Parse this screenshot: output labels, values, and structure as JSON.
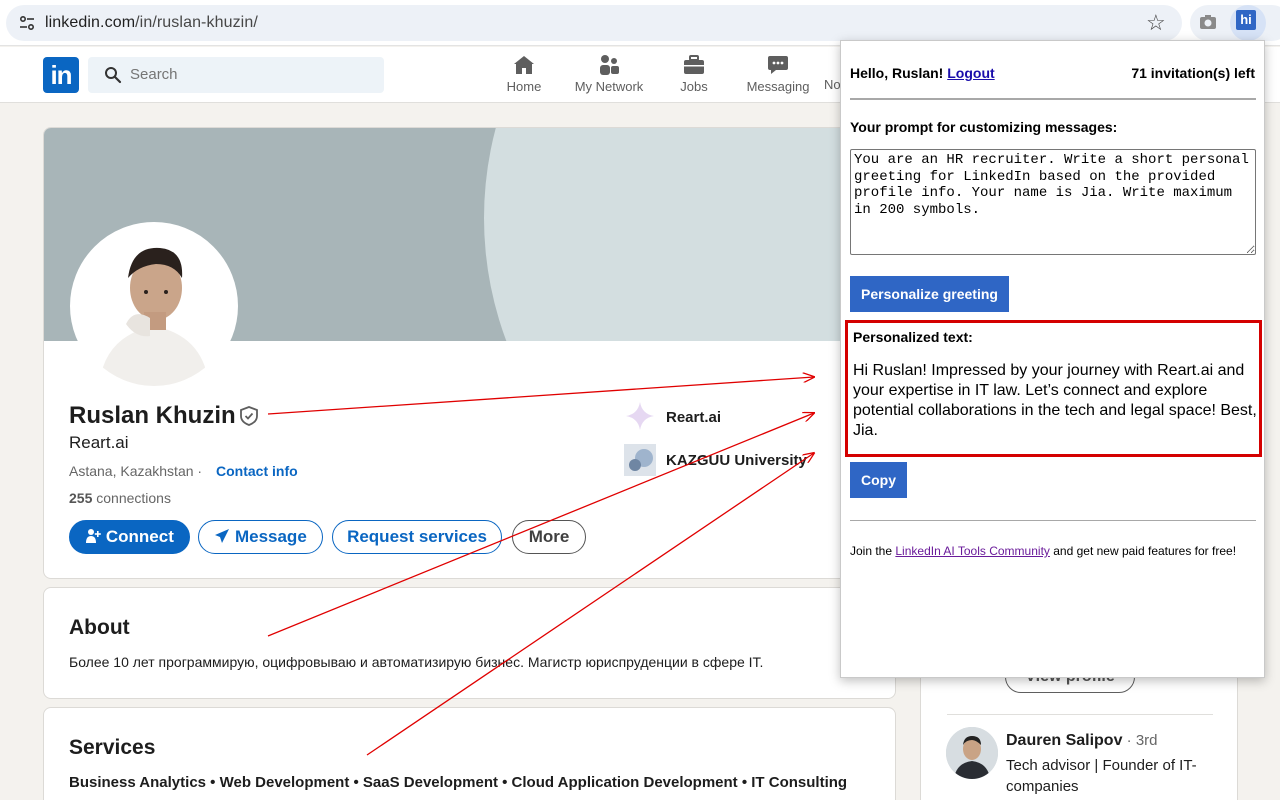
{
  "browser": {
    "url_host": "linkedin.com",
    "url_path": "/in/ruslan-khuzin/",
    "ext_label": "hi"
  },
  "nav": {
    "search_placeholder": "Search",
    "items": [
      {
        "label": "Home",
        "icon": "home-icon"
      },
      {
        "label": "My Network",
        "icon": "network-icon"
      },
      {
        "label": "Jobs",
        "icon": "briefcase-icon"
      },
      {
        "label": "Messaging",
        "icon": "messaging-icon"
      },
      {
        "label": "No",
        "icon": "notifications-icon"
      }
    ],
    "logo_text": "in"
  },
  "profile": {
    "name": "Ruslan Khuzin",
    "headline": "Reart.ai",
    "location": "Astana, Kazakhstan · ",
    "contact_info": "Contact info",
    "connections_count": "255",
    "connections_label": " connections",
    "buttons": {
      "connect": "Connect",
      "message": "Message",
      "request": "Request services",
      "more": "More"
    },
    "experience": [
      {
        "label": "Reart.ai"
      },
      {
        "label": "KAZGUU University"
      }
    ]
  },
  "about": {
    "title": "About",
    "text": "Более 10 лет программирую, оцифровываю и автоматизирую бизнес. Магистр юриспруденции в сфере IT."
  },
  "services": {
    "title": "Services",
    "text": "Business Analytics • Web Development • SaaS Development • Cloud Application Development • IT Consulting"
  },
  "sidebar": {
    "view_profile": "View profile",
    "person": {
      "name": "Dauren Salipov",
      "degree": " · 3rd",
      "title": "Tech advisor | Founder of IT-companies"
    }
  },
  "popup": {
    "hello": "Hello, Ruslan! ",
    "logout": "Logout",
    "invitations": "71 invitation(s) left",
    "prompt_label": "Your prompt for customizing messages:",
    "prompt_value": "You are an HR recruiter. Write a short personal greeting for LinkedIn based on the provided profile info. Your name is Jia. Write maximum in 200 symbols.",
    "personalize_button": "Personalize greeting",
    "result_label": "Personalized text:",
    "result_text": "Hi Ruslan! Impressed by your journey with Reart.ai and your expertise in IT law. Let’s connect and explore potential collaborations in the tech and legal space! Best, Jia.",
    "copy_button": "Copy",
    "join_prefix": "Join the ",
    "join_link": "LinkedIn AI Tools Community",
    "join_suffix": " and get new paid features for free!"
  },
  "colors": {
    "linkedin_blue": "#0a66c2",
    "popup_button": "#2f66c5",
    "highlight_border": "#d40000",
    "annotation_arrow": "#e00000"
  }
}
